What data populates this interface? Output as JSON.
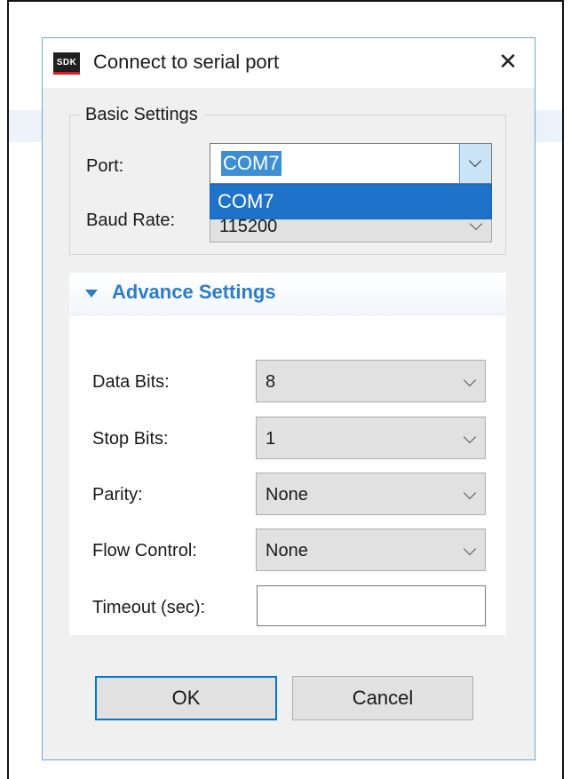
{
  "dialog": {
    "title": "Connect to serial port",
    "logo_text": "SDK",
    "close_glyph": "✕"
  },
  "basic_settings": {
    "legend": "Basic Settings",
    "port_label": "Port:",
    "port_value": "COM7",
    "port_options": [
      "COM7"
    ],
    "baud_label": "Baud Rate:",
    "baud_value": "115200"
  },
  "advance_settings": {
    "title": "Advance Settings",
    "data_bits_label": "Data Bits:",
    "data_bits_value": "8",
    "stop_bits_label": "Stop Bits:",
    "stop_bits_value": "1",
    "parity_label": "Parity:",
    "parity_value": "None",
    "flow_control_label": "Flow Control:",
    "flow_control_value": "None",
    "timeout_label": "Timeout (sec):",
    "timeout_value": ""
  },
  "buttons": {
    "ok": "OK",
    "cancel": "Cancel"
  },
  "colors": {
    "accent": "#2f7cc5",
    "selection": "#1e73c9",
    "dialog_border": "#6ea5dc"
  }
}
